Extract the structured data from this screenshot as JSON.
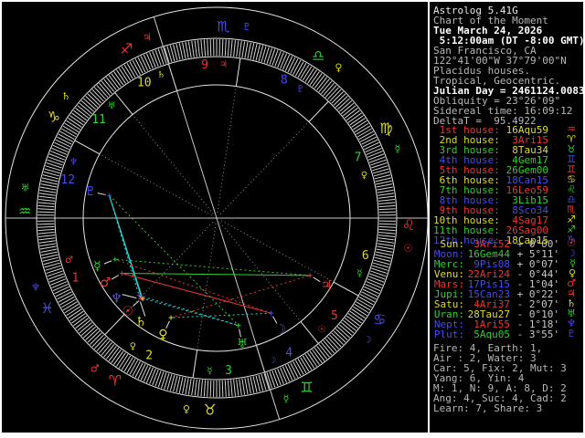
{
  "colors": {
    "red": "#ec3434",
    "green": "#2fd02f",
    "blue": "#4a4aee",
    "yellow": "#dede24",
    "cyan": "#2ad8d8",
    "gray": "#b8b8b8",
    "white": "#ffffff",
    "wheel_line": "#e6e6e6",
    "tick": "#d4d4d4",
    "dotted_cusp": "#8f8f8f",
    "axis": "#c8c8c8",
    "pointer": "#e0e0e0"
  },
  "header": {
    "lines": [
      {
        "text": "Astrolog 5.41G",
        "color": "#e8e8e8",
        "bold": false
      },
      {
        "text": "Chart of the Moment",
        "color": "#b8b8b8",
        "bold": false
      },
      {
        "text": "Tue March 24, 2026",
        "color": "#ffffff",
        "bold": true
      },
      {
        "text": " 5:12:00am (DT -8:00 GMT)",
        "color": "#ffffff",
        "bold": true
      },
      {
        "text": "San Francisco, CA",
        "color": "#b8b8b8",
        "bold": false
      },
      {
        "text": "122°41'00\"W 37°79'00\"N",
        "color": "#b8b8b8",
        "bold": false
      },
      {
        "text": "Placidus houses.",
        "color": "#b8b8b8",
        "bold": false
      },
      {
        "text": "Tropical, Geocentric.",
        "color": "#b8b8b8",
        "bold": false
      },
      {
        "text": "Julian Day = 2461124.0083",
        "color": "#ffffff",
        "bold": true
      },
      {
        "text": "Obliquity = 23°26'09\"",
        "color": "#b8b8b8",
        "bold": false
      },
      {
        "text": "Sidereal time: 16:09:12",
        "color": "#b8b8b8",
        "bold": false
      },
      {
        "text": "DeltaT =  95.4922",
        "color": "#b8b8b8",
        "bold": false
      }
    ]
  },
  "house_list": [
    {
      "label": " 1st house:",
      "value": "16Aqu59",
      "label_color": "red",
      "value_color": "yellow",
      "glyph": "♒",
      "glyph_color": "red"
    },
    {
      "label": " 2nd house:",
      "value": " 3Ari15",
      "label_color": "yellow",
      "value_color": "red",
      "glyph": "♈",
      "glyph_color": "yellow"
    },
    {
      "label": " 3rd house:",
      "value": " 8Tau34",
      "label_color": "green",
      "value_color": "yellow",
      "glyph": "♉",
      "glyph_color": "green"
    },
    {
      "label": " 4th house:",
      "value": " 4Gem17",
      "label_color": "blue",
      "value_color": "green",
      "glyph": "♊",
      "glyph_color": "blue"
    },
    {
      "label": " 5th house:",
      "value": "26Gem00",
      "label_color": "red",
      "value_color": "green",
      "glyph": "♊",
      "glyph_color": "red"
    },
    {
      "label": " 6th house:",
      "value": "18Can15",
      "label_color": "yellow",
      "value_color": "blue",
      "glyph": "♋",
      "glyph_color": "yellow"
    },
    {
      "label": " 7th house:",
      "value": "16Leo59",
      "label_color": "green",
      "value_color": "red",
      "glyph": "♌",
      "glyph_color": "green"
    },
    {
      "label": " 8th house:",
      "value": " 3Lib15",
      "label_color": "blue",
      "value_color": "green",
      "glyph": "♎",
      "glyph_color": "blue"
    },
    {
      "label": " 9th house:",
      "value": " 8Sco34",
      "label_color": "red",
      "value_color": "blue",
      "glyph": "♏",
      "glyph_color": "red"
    },
    {
      "label": "10th house:",
      "value": " 4Sag17",
      "label_color": "yellow",
      "value_color": "red",
      "glyph": "♐",
      "glyph_color": "yellow"
    },
    {
      "label": "11th house:",
      "value": "26Sag00",
      "label_color": "green",
      "value_color": "red",
      "glyph": "♐",
      "glyph_color": "green"
    },
    {
      "label": "12th house:",
      "value": "18Cap15",
      "label_color": "blue",
      "value_color": "yellow",
      "glyph": "♑",
      "glyph_color": "blue"
    }
  ],
  "planet_list": [
    {
      "label": " Sun:",
      "value": " 3Ari52",
      "motion": "+ 0°00'",
      "label_color": "yellow",
      "value_color": "red",
      "glyph": "☉",
      "glyph_color": "red"
    },
    {
      "label": "Moon:",
      "value": "16Gem44",
      "motion": "+ 5°11'",
      "label_color": "blue",
      "value_color": "green",
      "glyph": "☽",
      "glyph_color": "blue"
    },
    {
      "label": "Merc:",
      "value": " 9Pis08",
      "motion": "+ 0°07'",
      "label_color": "green",
      "value_color": "blue",
      "glyph": "☿",
      "glyph_color": "green"
    },
    {
      "label": "Venu:",
      "value": "22Ari24",
      "motion": "- 0°44'",
      "label_color": "yellow",
      "value_color": "red",
      "glyph": "♀",
      "glyph_color": "yellow"
    },
    {
      "label": "Mars:",
      "value": "17Pis15",
      "motion": "- 1°04'",
      "label_color": "red",
      "value_color": "blue",
      "glyph": "♂",
      "glyph_color": "red"
    },
    {
      "label": "Jupi:",
      "value": "15Can23",
      "motion": "+ 0°22'",
      "label_color": "green",
      "value_color": "blue",
      "glyph": "♃",
      "glyph_color": "red"
    },
    {
      "label": "Satu:",
      "value": " 4Ari37",
      "motion": "- 2°07'",
      "label_color": "yellow",
      "value_color": "red",
      "glyph": "♄",
      "glyph_color": "yellow"
    },
    {
      "label": "Uran:",
      "value": "28Tau27",
      "motion": "- 0°10'",
      "label_color": "green",
      "value_color": "yellow",
      "glyph": "♅",
      "glyph_color": "green"
    },
    {
      "label": "Nept:",
      "value": " 1Ari55",
      "motion": "- 1°18'",
      "label_color": "blue",
      "value_color": "red",
      "glyph": "♆",
      "glyph_color": "blue"
    },
    {
      "label": "Plut:",
      "value": " 5Aqu05",
      "motion": "- 3°55'",
      "label_color": "blue",
      "value_color": "green",
      "glyph": "♇",
      "glyph_color": "blue"
    }
  ],
  "stats": [
    "Fire: 4, Earth: 1,",
    "Air : 2, Water: 3",
    "Car: 5, Fix: 2, Mut: 3",
    "Yang: 6, Yin: 4",
    "M: 1, N: 9, A: 8, D: 2",
    "Ang: 4, Suc: 4, Cad: 2",
    "Learn: 7, Share: 3"
  ],
  "wheel": {
    "asc": 316.983,
    "cusps": [
      316.983,
      3.25,
      38.567,
      64.283,
      86.0,
      108.25,
      136.983,
      183.25,
      218.567,
      244.283,
      266.0,
      288.25
    ],
    "signs": [
      {
        "name": "aries",
        "glyph": "♈",
        "color": "red",
        "ruler_glyph": "♂",
        "ruler_color": "red"
      },
      {
        "name": "taurus",
        "glyph": "♉",
        "color": "yellow",
        "ruler_glyph": "♀",
        "ruler_color": "yellow"
      },
      {
        "name": "gemini",
        "glyph": "♊",
        "color": "green",
        "ruler_glyph": "☿",
        "ruler_color": "green"
      },
      {
        "name": "cancer",
        "glyph": "♋",
        "color": "blue",
        "ruler_glyph": "☽",
        "ruler_color": "blue"
      },
      {
        "name": "leo",
        "glyph": "♌",
        "color": "red",
        "ruler_glyph": "☉",
        "ruler_color": "red"
      },
      {
        "name": "virgo",
        "glyph": "♍",
        "color": "yellow",
        "ruler_glyph": "☿",
        "ruler_color": "green"
      },
      {
        "name": "libra",
        "glyph": "♎",
        "color": "green",
        "ruler_glyph": "♀",
        "ruler_color": "yellow"
      },
      {
        "name": "scorpio",
        "glyph": "♏",
        "color": "blue",
        "ruler_glyph": "♇",
        "ruler_color": "blue"
      },
      {
        "name": "sagittarius",
        "glyph": "♐",
        "color": "red",
        "ruler_glyph": "♃",
        "ruler_color": "red"
      },
      {
        "name": "capricorn",
        "glyph": "♑",
        "color": "yellow",
        "ruler_glyph": "♄",
        "ruler_color": "yellow"
      },
      {
        "name": "aquarius",
        "glyph": "♒",
        "color": "green",
        "ruler_glyph": "♅",
        "ruler_color": "green"
      },
      {
        "name": "pisces",
        "glyph": "♓",
        "color": "blue",
        "ruler_glyph": "♆",
        "ruler_color": "blue"
      }
    ],
    "houses": [
      {
        "number": "1",
        "color": "red",
        "ruler_glyph": "♂",
        "ruler_color": "red"
      },
      {
        "number": "2",
        "color": "yellow",
        "ruler_glyph": "♀",
        "ruler_color": "yellow"
      },
      {
        "number": "3",
        "color": "green",
        "ruler_glyph": "☿",
        "ruler_color": "green"
      },
      {
        "number": "4",
        "color": "blue",
        "ruler_glyph": "☽",
        "ruler_color": "blue"
      },
      {
        "number": "5",
        "color": "red",
        "ruler_glyph": "☉",
        "ruler_color": "red"
      },
      {
        "number": "6",
        "color": "yellow",
        "ruler_glyph": "☿",
        "ruler_color": "green"
      },
      {
        "number": "7",
        "color": "green",
        "ruler_glyph": "♀",
        "ruler_color": "yellow"
      },
      {
        "number": "8",
        "color": "blue",
        "ruler_glyph": "♇",
        "ruler_color": "blue"
      },
      {
        "number": "9",
        "color": "red",
        "ruler_glyph": "♃",
        "ruler_color": "red"
      },
      {
        "number": "10",
        "color": "yellow",
        "ruler_glyph": "♄",
        "ruler_color": "yellow"
      },
      {
        "number": "11",
        "color": "green",
        "ruler_glyph": "♅",
        "ruler_color": "green"
      },
      {
        "number": "12",
        "color": "blue",
        "ruler_glyph": "♆",
        "ruler_color": "blue"
      }
    ],
    "planets": [
      {
        "name": "Sun",
        "glyph": "☉",
        "color": "red",
        "lon": 3.867
      },
      {
        "name": "Moon",
        "glyph": "☽",
        "color": "blue",
        "lon": 76.733
      },
      {
        "name": "Mercury",
        "glyph": "☿",
        "color": "green",
        "lon": 339.133
      },
      {
        "name": "Venus",
        "glyph": "♀",
        "color": "yellow",
        "lon": 22.4
      },
      {
        "name": "Mars",
        "glyph": "♂",
        "color": "red",
        "lon": 347.25
      },
      {
        "name": "Jupiter",
        "glyph": "♃",
        "color": "red",
        "lon": 105.383
      },
      {
        "name": "Saturn",
        "glyph": "♄",
        "color": "yellow",
        "lon": 4.617
      },
      {
        "name": "Uranus",
        "glyph": "♅",
        "color": "green",
        "lon": 58.45
      },
      {
        "name": "Neptune",
        "glyph": "♆",
        "color": "blue",
        "lon": 1.917
      },
      {
        "name": "Pluto",
        "glyph": "♇",
        "color": "blue",
        "lon": 305.083
      }
    ],
    "aspects": [
      {
        "a": "Sun",
        "b": "Saturn",
        "color": "yellow",
        "dotted": false
      },
      {
        "a": "Sun",
        "b": "Neptune",
        "color": "yellow",
        "dotted": false
      },
      {
        "a": "Saturn",
        "b": "Neptune",
        "color": "yellow",
        "dotted": true
      },
      {
        "a": "Pluto",
        "b": "Saturn",
        "color": "cyan",
        "dotted": false
      },
      {
        "a": "Pluto",
        "b": "Sun",
        "color": "cyan",
        "dotted": false
      },
      {
        "a": "Pluto",
        "b": "Neptune",
        "color": "cyan",
        "dotted": true
      },
      {
        "a": "Sun",
        "b": "Uranus",
        "color": "cyan",
        "dotted": true
      },
      {
        "a": "Neptune",
        "b": "Uranus",
        "color": "cyan",
        "dotted": true
      },
      {
        "a": "Moon",
        "b": "Venus",
        "color": "cyan",
        "dotted": true
      },
      {
        "a": "Moon",
        "b": "Mars",
        "color": "red",
        "dotted": false
      },
      {
        "a": "Moon",
        "b": "Mercury",
        "color": "red",
        "dotted": true
      },
      {
        "a": "Venus",
        "b": "Jupiter",
        "color": "red",
        "dotted": true
      },
      {
        "a": "Jupiter",
        "b": "Mars",
        "color": "green",
        "dotted": false
      },
      {
        "a": "Jupiter",
        "b": "Mercury",
        "color": "green",
        "dotted": true
      },
      {
        "a": "Pluto",
        "b": "Uranus",
        "color": "green",
        "dotted": true
      }
    ]
  }
}
